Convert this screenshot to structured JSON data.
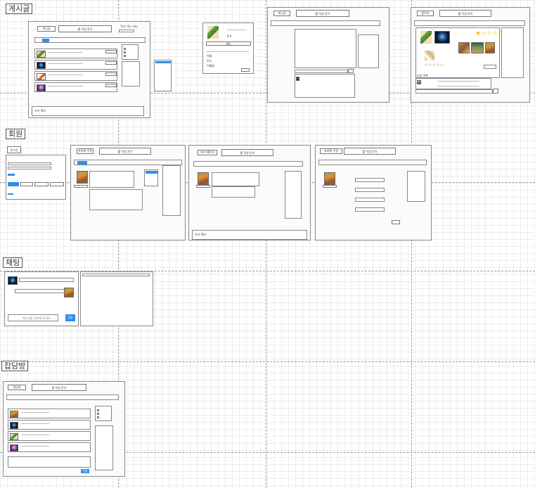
{
  "sections": {
    "board": "게시글",
    "member": "회원",
    "chat": "채팅",
    "chatroom": "잡담방"
  },
  "search_label": "를 작성 문기",
  "write_label": "게시글",
  "like_label": "좋아요",
  "profile_label": "프로필 수정",
  "mypage_label": "마이 페이지",
  "login_label": "로그인",
  "chat_input_placeholder": "메시지를 입력해 주세요",
  "send_label": "전송",
  "popup": {
    "price": "4.5",
    "action": "채팅",
    "fields": [
      "이름",
      "주소",
      "이메일"
    ]
  },
  "review_label": "리뷰 목록",
  "footer_label": "이거 뭐야",
  "star_rating": 1,
  "colors": {
    "accent": "#2b8ef0",
    "grid": "#ececec"
  }
}
